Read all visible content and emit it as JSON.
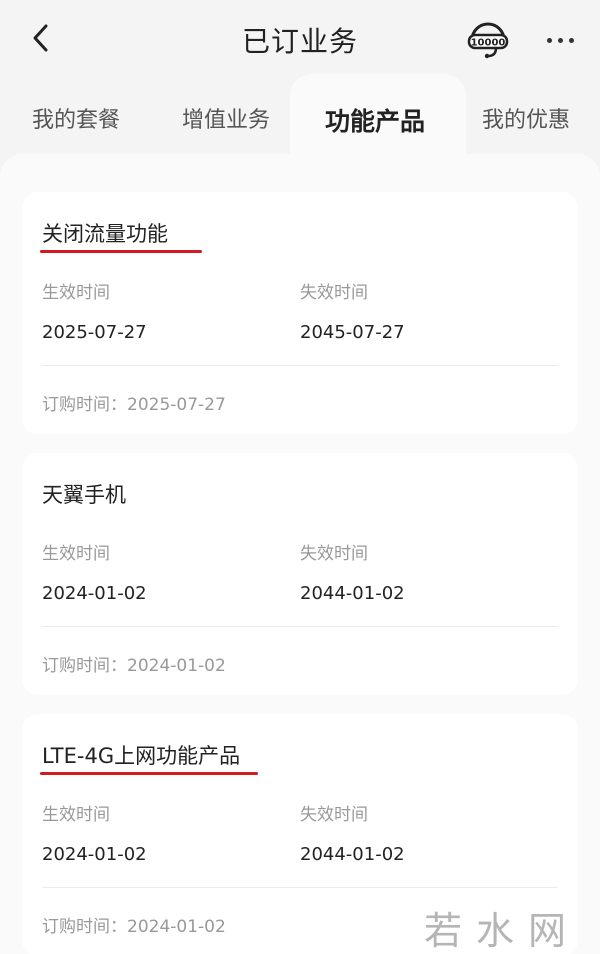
{
  "header": {
    "title": "已订业务",
    "hotline_icon": "10000-customer-service-icon",
    "more_icon": "more-dots-icon",
    "back_icon": "back-chevron-icon"
  },
  "tabs": [
    {
      "label": "我的套餐",
      "active": false
    },
    {
      "label": "增值业务",
      "active": false
    },
    {
      "label": "功能产品",
      "active": true
    },
    {
      "label": "我的优惠",
      "active": false
    }
  ],
  "labels": {
    "start": "生效时间",
    "end": "失效时间",
    "order_prefix": "订购时间："
  },
  "products": [
    {
      "name": "关闭流量功能",
      "start": "2025-07-27",
      "end": "2045-07-27",
      "order": "2025-07-27",
      "highlighted": true
    },
    {
      "name": "天翼手机",
      "start": "2024-01-02",
      "end": "2044-01-02",
      "order": "2024-01-02",
      "highlighted": false
    },
    {
      "name": "LTE-4G上网功能产品",
      "start": "2024-01-02",
      "end": "2044-01-02",
      "order": "2024-01-02",
      "highlighted": true
    }
  ],
  "colors": {
    "accent_underline": "#d21a22",
    "background": "#f4f4f4",
    "card": "#ffffff"
  },
  "watermark": "若水网"
}
